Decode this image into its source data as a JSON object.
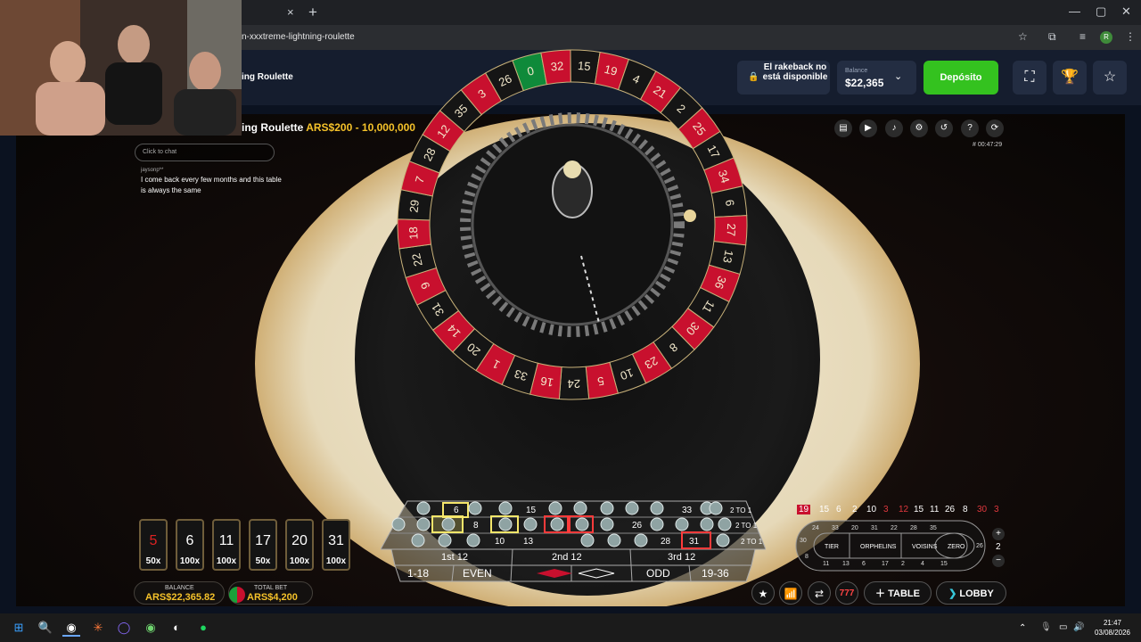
{
  "browser": {
    "url": "n-xxxtreme-lightning-roulette",
    "new_tab": "+",
    "tab_close": "×"
  },
  "casino": {
    "title": "ing Roulette",
    "rakeback": "El rakeback no está disponible",
    "balance_label": "Balance",
    "balance_value": "$22,365",
    "deposit_label": "Depósito"
  },
  "game": {
    "title": "ing Roulette",
    "limits": "ARS$200 - 10,000,000",
    "timer": "# 00:47:29",
    "chat_placeholder": "Click to chat",
    "chat_user": "jaysonp**",
    "chat_message": "I come back every few months and this table is always the same"
  },
  "wheel": {
    "numbers": [
      "0",
      "32",
      "15",
      "19",
      "4",
      "21",
      "2",
      "25",
      "17",
      "34",
      "6",
      "27",
      "13",
      "36",
      "11",
      "30",
      "8",
      "23",
      "10",
      "5",
      "24",
      "16",
      "33",
      "1",
      "20",
      "14",
      "31",
      "9",
      "22",
      "18",
      "29",
      "7",
      "28",
      "12",
      "35",
      "3",
      "26"
    ],
    "red": [
      "32",
      "19",
      "21",
      "25",
      "34",
      "27",
      "36",
      "30",
      "23",
      "5",
      "16",
      "1",
      "14",
      "9",
      "18",
      "7",
      "12",
      "3"
    ],
    "green": [
      "0"
    ],
    "colors": {
      "red": "#c8102e",
      "black": "#151515",
      "green": "#0f8a3a"
    }
  },
  "lightning": [
    {
      "number": "5",
      "multiplier": "50x",
      "color": "#d22"
    },
    {
      "number": "6",
      "multiplier": "100x",
      "color": "#fff"
    },
    {
      "number": "11",
      "multiplier": "100x",
      "color": "#fff"
    },
    {
      "number": "17",
      "multiplier": "50x",
      "color": "#fff"
    },
    {
      "number": "20",
      "multiplier": "100x",
      "color": "#fff"
    },
    {
      "number": "31",
      "multiplier": "100x",
      "color": "#fff"
    }
  ],
  "table": {
    "row_top": [
      "6",
      "15",
      "33"
    ],
    "row_mid": [
      "8",
      "26"
    ],
    "row_bot": [
      "10",
      "13",
      "28",
      "31"
    ],
    "columns": [
      "2 TO 1",
      "2 TO 1",
      "2 TO 1"
    ],
    "dozens": [
      "1st 12",
      "2nd 12",
      "3rd 12"
    ],
    "outside": [
      "1-18",
      "EVEN",
      "ODD",
      "19-36"
    ]
  },
  "history": [
    {
      "n": "19",
      "c": "red-box"
    },
    {
      "n": "15",
      "c": "white"
    },
    {
      "n": "6",
      "c": "white"
    },
    {
      "n": "2",
      "c": "white"
    },
    {
      "n": "10",
      "c": "white"
    },
    {
      "n": "3",
      "c": "red"
    },
    {
      "n": "12",
      "c": "red"
    },
    {
      "n": "15",
      "c": "white"
    },
    {
      "n": "11",
      "c": "white"
    },
    {
      "n": "26",
      "c": "white"
    },
    {
      "n": "8",
      "c": "white"
    },
    {
      "n": "30",
      "c": "red"
    },
    {
      "n": "3",
      "c": "red"
    }
  ],
  "racetrack": {
    "sections": [
      "TIER",
      "ORPHELINS",
      "VOISINS",
      "ZERO"
    ],
    "top_numbers": [
      "24",
      "33",
      "20",
      "31",
      "22",
      "28",
      "35"
    ],
    "bottom_numbers": [
      "11",
      "13",
      "6",
      "17",
      "2",
      "4",
      "15"
    ],
    "left_numbers": [
      "30",
      "8"
    ],
    "right_numbers": [
      "26"
    ],
    "counter": "2"
  },
  "bottom": {
    "balance_label": "BALANCE",
    "balance_value": "ARS$22,365.82",
    "totalbet_label": "TOTAL BET",
    "totalbet_value": "ARS$4,200",
    "table_label": "TABLE",
    "lobby_label": "LOBBY",
    "slots_label": "777"
  },
  "taskbar": {
    "time": "21:47",
    "date": "03/08/2026"
  }
}
